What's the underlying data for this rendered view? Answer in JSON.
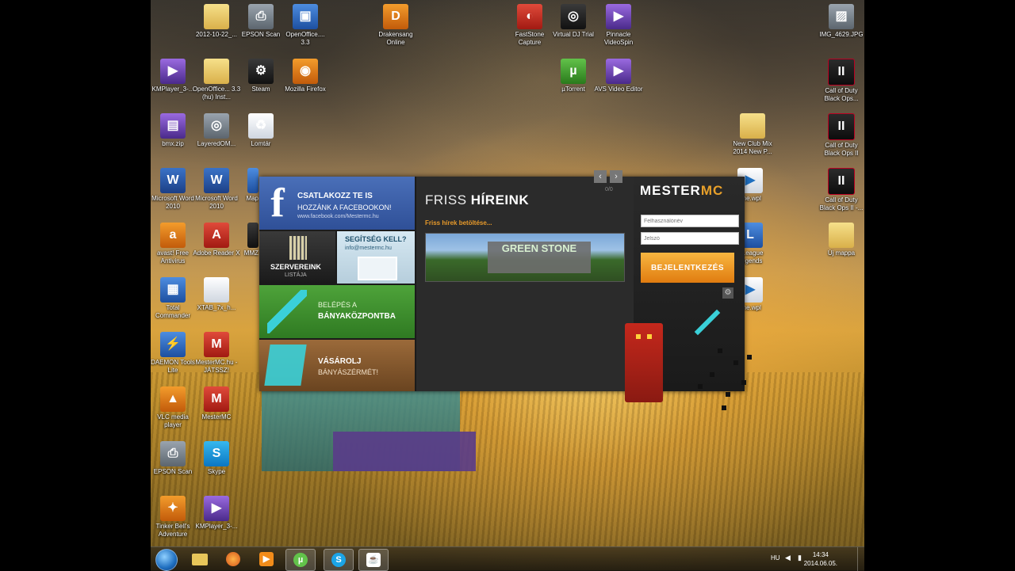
{
  "desktop": {
    "icons": [
      {
        "label": "2012-10-22_...",
        "icon": "folder-icon"
      },
      {
        "label": "EPSON Scan",
        "icon": "scanner-icon"
      },
      {
        "label": "OpenOffice.... 3.3",
        "icon": "openoffice-icon"
      },
      {
        "label": "Drakensang Online",
        "icon": "drakensang-icon"
      },
      {
        "label": "FastStone Capture",
        "icon": "faststone-icon"
      },
      {
        "label": "Virtual DJ Trial",
        "icon": "virtualdj-icon"
      },
      {
        "label": "Pinnacle VideoSpin",
        "icon": "pinnacle-icon"
      },
      {
        "label": "IMG_4629.JPG",
        "icon": "image-icon"
      },
      {
        "label": "KMPlayer_3-...",
        "icon": "kmplayer-icon"
      },
      {
        "label": "OpenOffice... 3.3 (hu) Inst...",
        "icon": "folder-icon"
      },
      {
        "label": "Steam",
        "icon": "steam-icon"
      },
      {
        "label": "Mozilla Firefox",
        "icon": "firefox-icon"
      },
      {
        "label": "µTorrent",
        "icon": "utorrent-icon"
      },
      {
        "label": "AVS Video Editor",
        "icon": "avs-icon"
      },
      {
        "label": "Call of Duty Black Ops...",
        "icon": "cod-icon"
      },
      {
        "label": "bmx.zip",
        "icon": "archive-icon"
      },
      {
        "label": "LayeredOM...",
        "icon": "layeredom-icon"
      },
      {
        "label": "Lomtár",
        "icon": "recycle-bin-icon"
      },
      {
        "label": "New Club Mix 2014 New P...",
        "icon": "folder-icon"
      },
      {
        "label": "Call of Duty Black Ops II",
        "icon": "cod-icon"
      },
      {
        "label": "Microsoft Word 2010",
        "icon": "word-icon"
      },
      {
        "label": "Microsoft Word 2010",
        "icon": "word-icon"
      },
      {
        "label": "Map",
        "icon": "map-icon"
      },
      {
        "label": "ene.wpl",
        "icon": "playlist-icon"
      },
      {
        "label": "Call of Duty Black Ops II -...",
        "icon": "cod-icon"
      },
      {
        "label": "avast! Free Antivirus",
        "icon": "avast-icon"
      },
      {
        "label": "Adobe Reader X",
        "icon": "pdf-icon"
      },
      {
        "label": "MMZ",
        "icon": "app-icon"
      },
      {
        "label": "y League Legends",
        "icon": "lol-icon"
      },
      {
        "label": "Új mappa",
        "icon": "folder-icon"
      },
      {
        "label": "Total Commander",
        "icon": "total-commander-icon"
      },
      {
        "label": "XTAB_7x_h...",
        "icon": "file-icon"
      },
      {
        "label": "ene.wpl",
        "icon": "playlist-icon"
      },
      {
        "label": "DAEMON Tools Lite",
        "icon": "daemon-icon"
      },
      {
        "label": "MesterMC.hu - JÁTSSZ!",
        "icon": "mestermc-icon"
      },
      {
        "label": "VLC media player",
        "icon": "vlc-icon"
      },
      {
        "label": "MesterMC",
        "icon": "mestermc-icon"
      },
      {
        "label": "EPSON Scan",
        "icon": "scanner-icon"
      },
      {
        "label": "Skype",
        "icon": "skype-icon"
      },
      {
        "label": "Tinker Bell's Adventure",
        "icon": "tinkerbell-icon"
      },
      {
        "label": "KMPlayer_3-...",
        "icon": "kmplayer-icon"
      }
    ]
  },
  "launcher": {
    "facebook": {
      "title": "CSATLAKOZZ TE IS",
      "subtitle": "HOZZÁNK A FACEBOOKON!",
      "url": "www.facebook.com/Mestermc.hu"
    },
    "servers": {
      "title": "SZERVEREINK",
      "subtitle": "LISTÁJA"
    },
    "help": {
      "title": "SEGÍTSÉG KELL?",
      "email": "info@mestermc.hu"
    },
    "mine": {
      "title": "BELÉPÉS A",
      "subtitle": "BÁNYAKÖZPONTBA"
    },
    "shop": {
      "title": "VÁSÁROLJ",
      "subtitle": "BÁNYÁSZÉRMÉT!"
    },
    "news": {
      "title_light": "FRISS",
      "title_bold": "HÍREINK",
      "loading": "Friss hírek betöltése...",
      "page_counter": "0/0",
      "banner_text": "GREEN STONE"
    },
    "login": {
      "logo_a": "MESTER",
      "logo_b": "MC",
      "username_placeholder": "Felhasználónév",
      "password_placeholder": "Jelszó",
      "login_button": "BEJELENTKEZÉS"
    }
  },
  "taskbar": {
    "apps": [
      {
        "name": "explorer",
        "icon": "folder-icon"
      },
      {
        "name": "firefox",
        "icon": "firefox-icon"
      },
      {
        "name": "media-player",
        "icon": "play-icon"
      },
      {
        "name": "utorrent",
        "icon": "utorrent-icon"
      },
      {
        "name": "skype",
        "icon": "skype-icon"
      },
      {
        "name": "java",
        "icon": "java-icon"
      }
    ],
    "language": "HU",
    "time": "14:34",
    "date": "2014.06.05."
  }
}
